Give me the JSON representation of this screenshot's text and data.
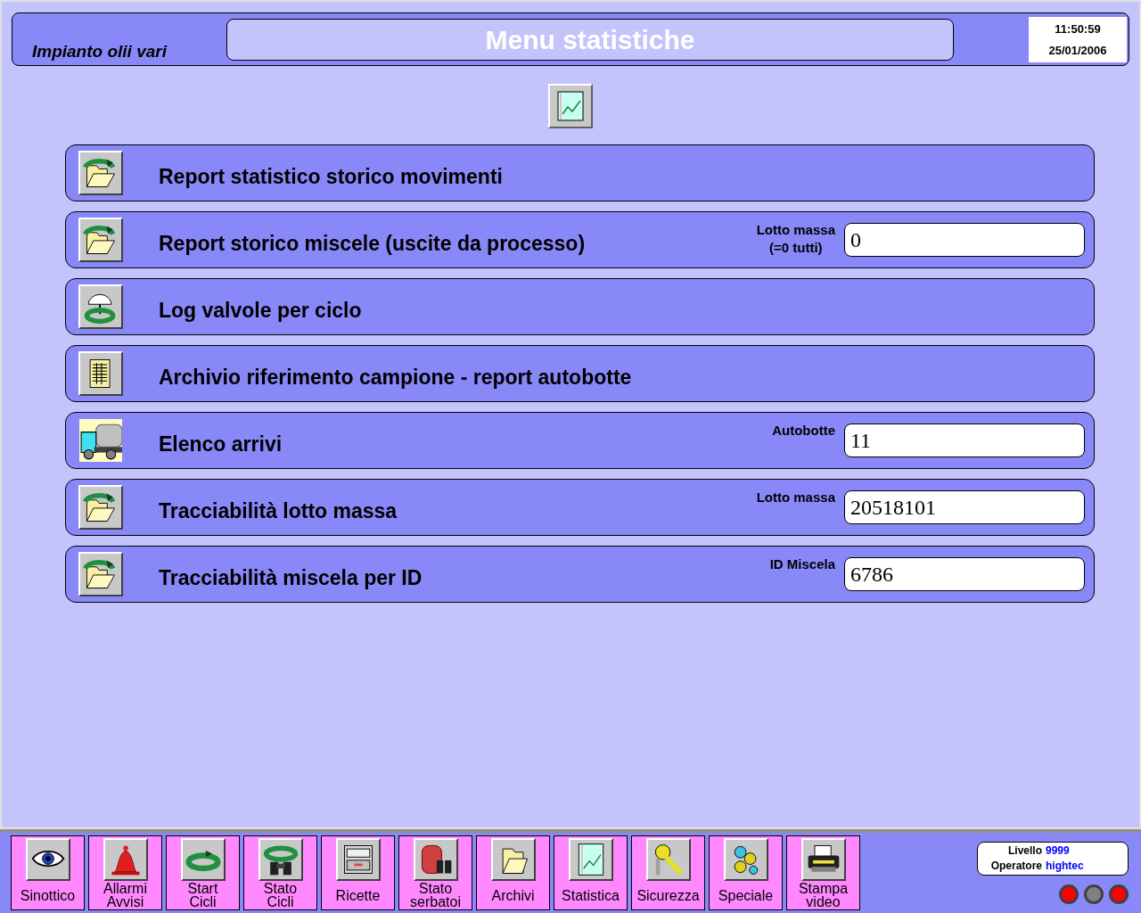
{
  "header": {
    "plant": "Impianto olii vari",
    "title": "Menu statistiche",
    "time": "11:50:59",
    "date": "25/01/2006"
  },
  "menu": [
    {
      "label": "Report statistico storico movimenti",
      "kind": "folder-cycle"
    },
    {
      "label": "Report storico miscele (uscite da processo)",
      "kind": "folder-cycle",
      "field": {
        "label": "Lotto massa",
        "note": "(=0 tutti)",
        "value": "0"
      }
    },
    {
      "label": "Log valvole per ciclo",
      "kind": "valve-cycle"
    },
    {
      "label": "Archivio riferimento campione - report autobotte",
      "kind": "document"
    },
    {
      "label": "Elenco arrivi",
      "kind": "truck",
      "field": {
        "label": "Autobotte",
        "value": "11"
      }
    },
    {
      "label": "Tracciabilità lotto massa",
      "kind": "folder-cycle",
      "field": {
        "label": "Lotto massa",
        "value": "20518101"
      }
    },
    {
      "label": "Tracciabilità miscela per ID",
      "kind": "folder-cycle",
      "field": {
        "label": "ID Miscela",
        "value": "6786"
      }
    }
  ],
  "nav": [
    {
      "label": "Sinottico",
      "kind": "eye"
    },
    {
      "label": "Allarmi\nAvvisi",
      "kind": "bell"
    },
    {
      "label": "Start\nCicli",
      "kind": "cycle"
    },
    {
      "label": "Stato\nCicli",
      "kind": "binoculars-cycle"
    },
    {
      "label": "Ricette",
      "kind": "drawer"
    },
    {
      "label": "Stato\nserbatoi",
      "kind": "tank"
    },
    {
      "label": "Archivi",
      "kind": "folder"
    },
    {
      "label": "Statistica",
      "kind": "chart"
    },
    {
      "label": "Sicurezza",
      "kind": "key"
    },
    {
      "label": "Speciale",
      "kind": "gears"
    },
    {
      "label": "Stampa\nvideo",
      "kind": "printer"
    }
  ],
  "user": {
    "level_label": "Livello",
    "level": "9999",
    "operator_label": "Operatore",
    "operator": "hightec"
  },
  "lamps": [
    {
      "color": "#ff0000"
    },
    {
      "color": "#808080"
    },
    {
      "color": "#ff0000"
    }
  ]
}
